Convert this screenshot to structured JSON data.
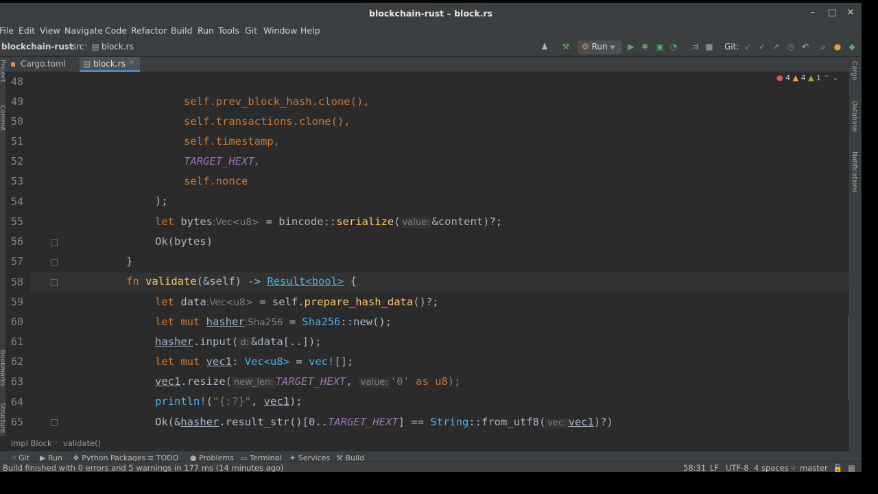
{
  "window": {
    "title": "blockchain-rust – block.rs",
    "minimize": "–",
    "maximize": "□",
    "close": "✕"
  },
  "menu": [
    "File",
    "Edit",
    "View",
    "Navigate",
    "Code",
    "Refactor",
    "Build",
    "Run",
    "Tools",
    "Git",
    "Window",
    "Help"
  ],
  "navbar": {
    "project": "blockchain-rust",
    "folder": "src",
    "file": "block.rs",
    "run_label": "Run",
    "git_label": "Git:"
  },
  "tabs": [
    {
      "label": "Cargo.toml",
      "active": false
    },
    {
      "label": "block.rs",
      "active": true
    }
  ],
  "inspections": {
    "errors": "4",
    "warnings": "4",
    "weak": "1"
  },
  "right_strip": {
    "cargo": "Cargo",
    "database": "Database",
    "notifications": "Notifications"
  },
  "left_strip": {
    "project": "Project",
    "commit": "Commit",
    "bookmarks": "Bookmarks",
    "structure": "Structure"
  },
  "editor": {
    "line_numbers": [
      "48",
      "49",
      "50",
      "51",
      "52",
      "53",
      "54",
      "55",
      "56",
      "57",
      "58",
      "59",
      "60",
      "61",
      "62",
      "63",
      "64",
      "65"
    ],
    "l48": "self.prev_block_hash.clone(),",
    "l49": "self.transactions.clone(),",
    "l50": "self.timestamp,",
    "l51": "TARGET_HEXT,",
    "l52": "self.nonce",
    "l53": ");",
    "l54": {
      "a": "let ",
      "b": "bytes",
      "hint": ":Vec<u8>",
      "c": " = bincode::",
      "d": "serialize",
      "e": "(",
      "hint2": "value:",
      "f": "&content)?;"
    },
    "l55": "Ok(bytes)",
    "l56": "}",
    "l57": {
      "a": "fn ",
      "b": "validate",
      "c": "(&self) -> ",
      "d": "Result<bool>",
      "e": " {"
    },
    "l58": {
      "a": "let ",
      "b": "data",
      "hint": ":Vec<u8>",
      "c": " = self.",
      "d": "prepare_hash_data",
      "e": "()?;"
    },
    "l59": {
      "a": "let mut ",
      "b": "hasher",
      "hint": ":Sha256",
      "c": " = ",
      "d": "Sha256",
      "e": "::new();"
    },
    "l60": {
      "a": "hasher",
      "b": ".input(",
      "hint": "d:",
      "c": "&data[..]);"
    },
    "l61": {
      "a": "let mut ",
      "b": "vec1",
      "c": ": ",
      "d": "Vec<u8>",
      "e": " = ",
      "f": "vec!",
      "g": "[];"
    },
    "l62": {
      "a": "vec1",
      "b": ".resize(",
      "hint": "new_len:",
      "c": "TARGET_HEXT",
      "d": ", ",
      "hint2": "value:",
      "e": "'0'",
      "f": " as u8);"
    },
    "l63": {
      "a": "println!",
      "b": "(",
      "c": "\"{:?}\"",
      "d": ", ",
      "e": "vec1",
      "f": ");"
    },
    "l64": {
      "a": "Ok(&",
      "b": "hasher",
      "c": ".result_str()[0..",
      "d": "TARGET_HEXT",
      "e": "] == ",
      "f": "String",
      "g": "::from_utf8(",
      "hint": "vec:",
      "h": "vec1",
      "i": ")?)"
    },
    "l65": "}"
  },
  "bottom_breadcrumb": {
    "a": "impl Block",
    "b": "validate()"
  },
  "tool_windows": [
    "Git",
    "Run",
    "Python Packages",
    "TODO",
    "Problems",
    "Terminal",
    "Services",
    "Build"
  ],
  "status": {
    "message": "Build finished with 0 errors and 5 warnings in 177 ms (14 minutes ago)",
    "position": "58:31",
    "line_sep": "LF",
    "encoding": "UTF-8",
    "indent": "4 spaces",
    "branch": "master"
  },
  "colors": {
    "keyword": "#cc7832",
    "field": "#9876aa",
    "function": "#ffc66d",
    "string": "#6a8759",
    "accent": "#4a88c7"
  }
}
